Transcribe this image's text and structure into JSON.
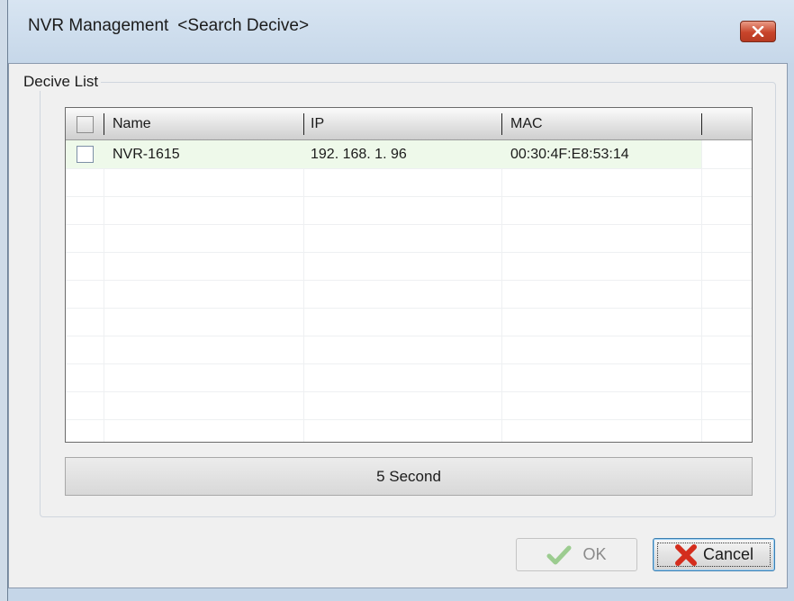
{
  "window": {
    "title": "NVR Management",
    "subtitle": "<Search Decive>"
  },
  "group": {
    "label": "Decive List"
  },
  "list": {
    "columns": [
      "Name",
      "IP",
      "MAC"
    ],
    "rows": [
      {
        "checked": false,
        "name": "NVR-1615",
        "ip": "192. 168. 1. 96",
        "mac": "00:30:4F:E8:53:14"
      }
    ]
  },
  "status": {
    "text": "5 Second"
  },
  "buttons": {
    "ok_label": "OK",
    "cancel_label": "Cancel"
  },
  "icons": {
    "close": "close-icon",
    "ok": "checkmark-icon",
    "cancel": "x-icon"
  },
  "colors": {
    "selected_row": "#eef9ea",
    "close_button": "#c8452b"
  }
}
